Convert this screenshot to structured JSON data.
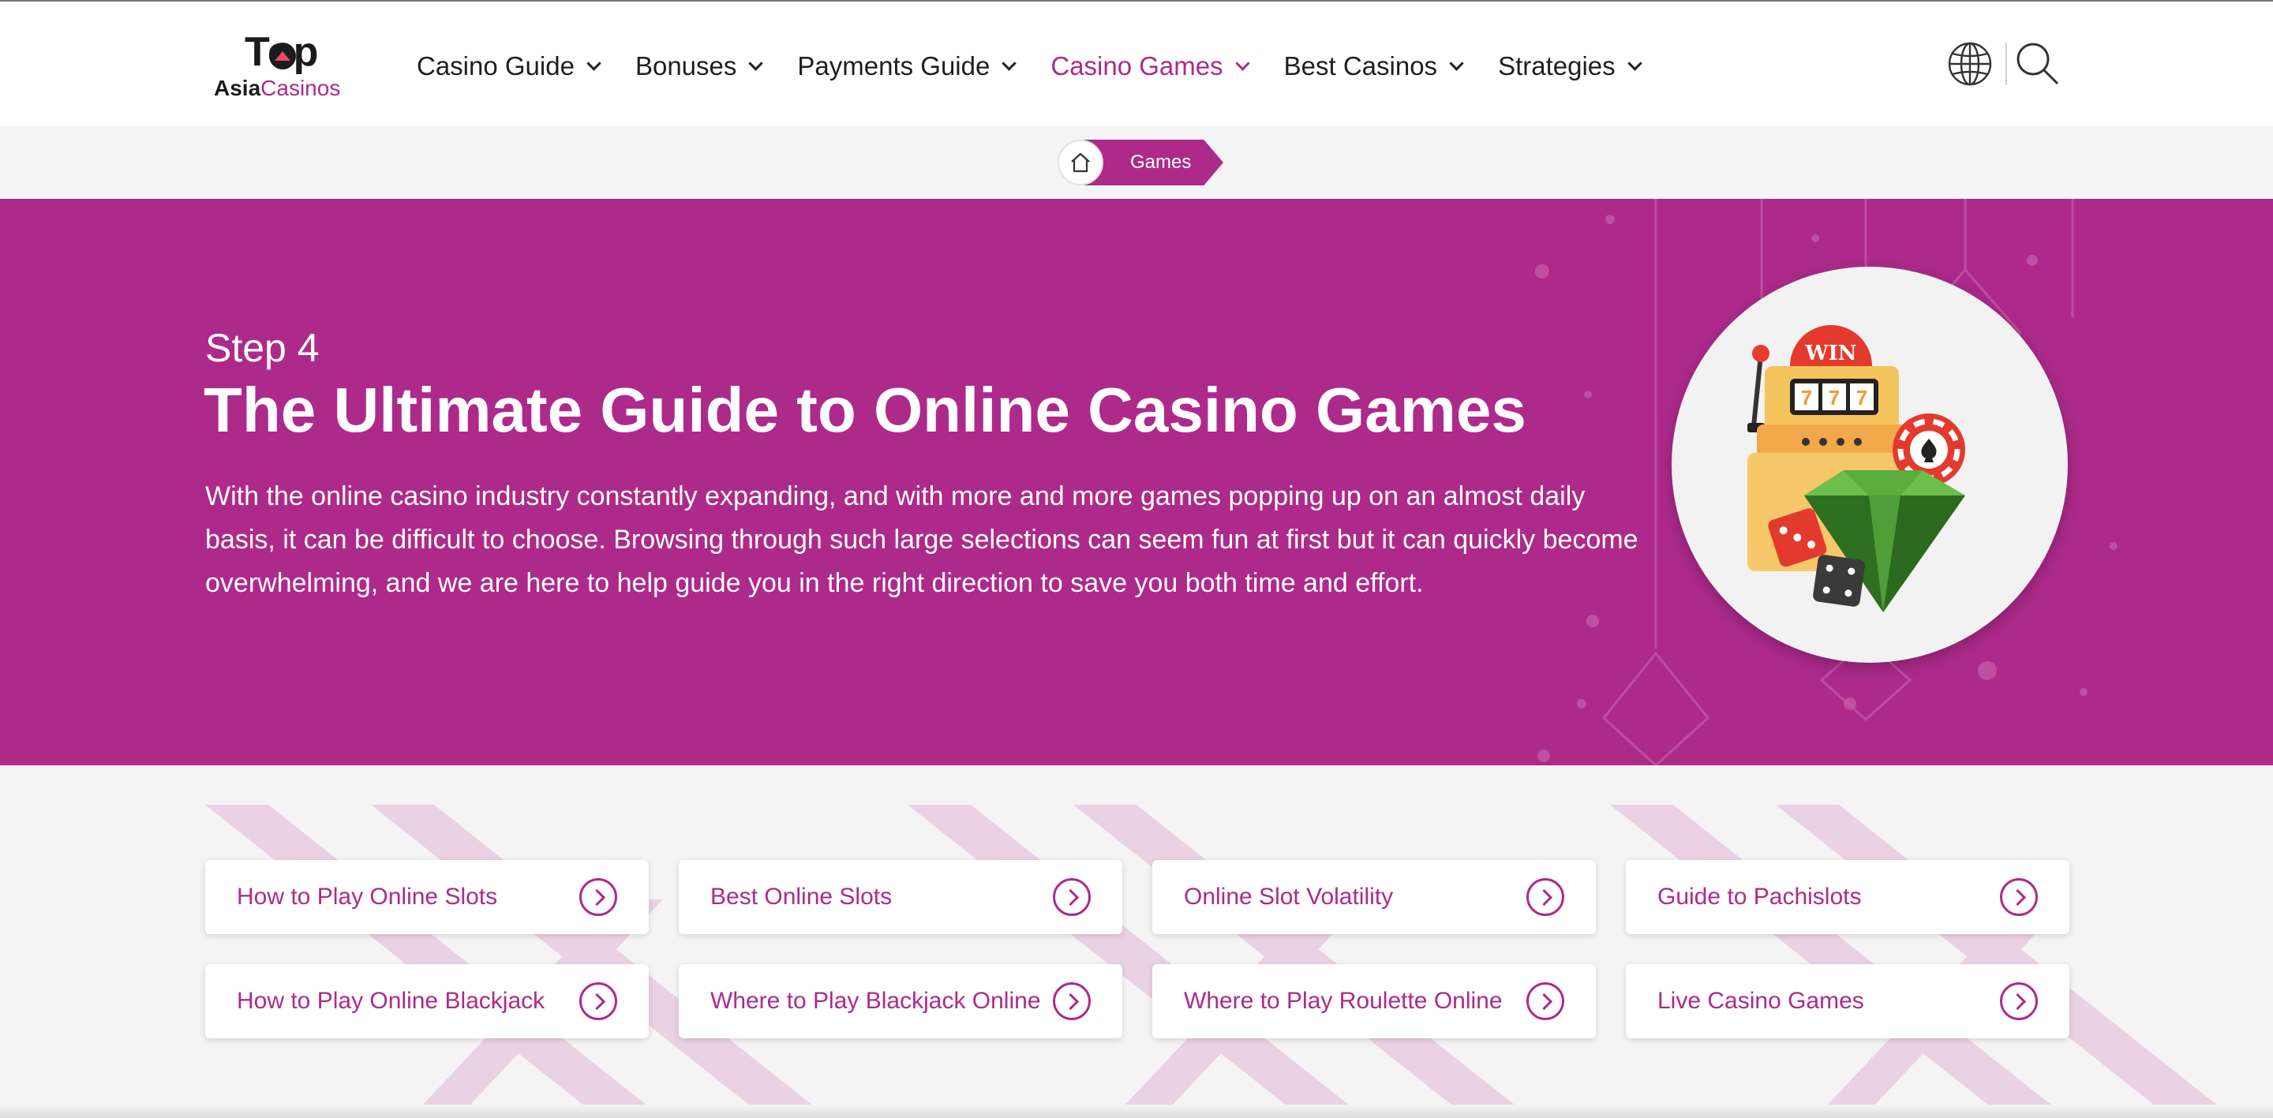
{
  "brand": {
    "logo_top": "Top",
    "logo_asia": "Asia",
    "logo_casinos": "Casinos"
  },
  "nav": [
    {
      "label": "Casino Guide",
      "active": false
    },
    {
      "label": "Bonuses",
      "active": false
    },
    {
      "label": "Payments Guide",
      "active": false
    },
    {
      "label": "Casino Games",
      "active": true
    },
    {
      "label": "Best Casinos",
      "active": false
    },
    {
      "label": "Strategies",
      "active": false
    }
  ],
  "header_icons": [
    "globe-icon",
    "search-icon"
  ],
  "breadcrumb": {
    "home_icon": "home-icon",
    "current": "Games"
  },
  "hero": {
    "step": "Step 4",
    "title": "The Ultimate Guide to Online Casino Games",
    "description": "With the online casino industry constantly expanding, and with more and more games popping up on an almost daily basis, it can be difficult to choose. Browsing through such large selections can seem fun at first but it can quickly become overwhelming, and we are here to help guide you in the right direction to save you both time and effort.",
    "illustration": {
      "sign": "WIN",
      "reels": [
        "7",
        "7",
        "7"
      ]
    }
  },
  "links": [
    {
      "label": "How to Play Online Slots"
    },
    {
      "label": "Best Online Slots"
    },
    {
      "label": "Online Slot Volatility"
    },
    {
      "label": "Guide to Pachislots"
    },
    {
      "label": "How to Play Online Blackjack"
    },
    {
      "label": "Where to Play Blackjack Online"
    },
    {
      "label": "Where to Play Roulette Online"
    },
    {
      "label": "Live Casino Games"
    }
  ],
  "colors": {
    "brand": "#ad2a8b",
    "text": "#1f1f1f",
    "background": "#f4f4f4"
  }
}
